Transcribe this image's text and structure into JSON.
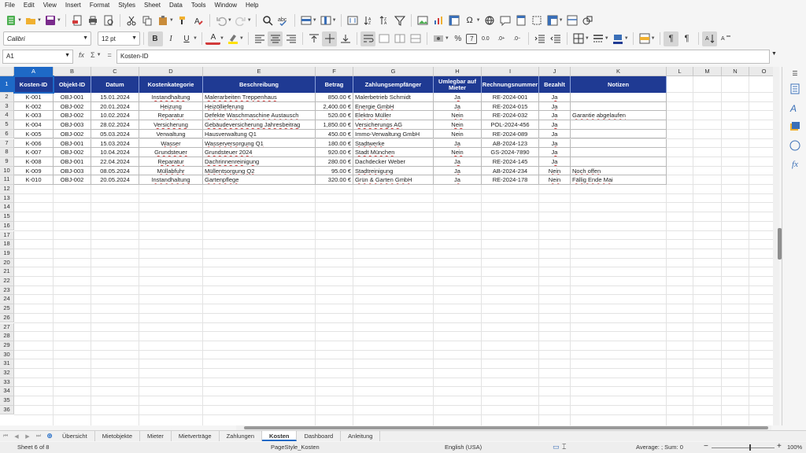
{
  "menu": [
    "File",
    "Edit",
    "View",
    "Insert",
    "Format",
    "Styles",
    "Sheet",
    "Data",
    "Tools",
    "Window",
    "Help"
  ],
  "format_toolbar": {
    "font_name": "Calibri",
    "font_size": "12 pt",
    "bold": "B",
    "italic": "I",
    "underline": "U",
    "font_color_glyph": "A",
    "percent": "%",
    "decimal_label": "0.0"
  },
  "formula_bar": {
    "cell_ref": "A1",
    "fx": "fx",
    "sigma": "Σ",
    "equals": "=",
    "content": "Kosten-ID"
  },
  "columns": [
    "A",
    "B",
    "C",
    "D",
    "E",
    "F",
    "G",
    "H",
    "I",
    "J",
    "K",
    "L",
    "M",
    "N",
    "O"
  ],
  "row_numbers": [
    "1",
    "2",
    "3",
    "4",
    "5",
    "6",
    "7",
    "8",
    "9",
    "10",
    "11",
    "12",
    "13",
    "14",
    "15",
    "16",
    "17",
    "18",
    "19",
    "20",
    "21",
    "22",
    "23",
    "24",
    "25",
    "26",
    "27",
    "28",
    "29",
    "30",
    "31",
    "32",
    "33",
    "34",
    "35",
    "36"
  ],
  "table": {
    "headers": [
      "Kosten-ID",
      "Objekt-ID",
      "Datum",
      "Kostenkategorie",
      "Beschreibung",
      "Betrag",
      "Zahlungsempfänger",
      "Umlegbar auf Mieter",
      "Rechnungsnummer",
      "Bezahlt",
      "Notizen"
    ],
    "rows": [
      [
        "K-001",
        "OBJ-001",
        "15.01.2024",
        "Instandhaltung",
        "Malerarbeiten Treppenhaus",
        "850.00 €",
        "Malerbetrieb Schmidt",
        "Ja",
        "RE-2024-001",
        "Ja",
        ""
      ],
      [
        "K-002",
        "OBJ-002",
        "20.01.2024",
        "Heizung",
        "Heizöllieferung",
        "2,400.00 €",
        "Energie GmbH",
        "Ja",
        "RE-2024-015",
        "Ja",
        ""
      ],
      [
        "K-003",
        "OBJ-002",
        "10.02.2024",
        "Reparatur",
        "Defekte Waschmaschine Austausch",
        "520.00 €",
        "Elektro Müller",
        "Nein",
        "RE-2024-032",
        "Ja",
        "Garantie abgelaufen"
      ],
      [
        "K-004",
        "OBJ-003",
        "28.02.2024",
        "Versicherung",
        "Gebäudeversicherung Jahresbeitrag",
        "1,850.00 €",
        "Versicherungs AG",
        "Nein",
        "POL-2024-456",
        "Ja",
        ""
      ],
      [
        "K-005",
        "OBJ-002",
        "05.03.2024",
        "Verwaltung",
        "Hausverwaltung Q1",
        "450.00 €",
        "Immo-Verwaltung GmbH",
        "Nein",
        "RE-2024-089",
        "Ja",
        ""
      ],
      [
        "K-006",
        "OBJ-001",
        "15.03.2024",
        "Wasser",
        "Wasserversorgung Q1",
        "180.00 €",
        "Stadtwerke",
        "Ja",
        "AB-2024-123",
        "Ja",
        ""
      ],
      [
        "K-007",
        "OBJ-002",
        "10.04.2024",
        "Grundsteuer",
        "Grundsteuer 2024",
        "920.00 €",
        "Stadt München",
        "Nein",
        "GS-2024-7890",
        "Ja",
        ""
      ],
      [
        "K-008",
        "OBJ-001",
        "22.04.2024",
        "Reparatur",
        "Dachrinnenreinigung",
        "280.00 €",
        "Dachdecker Weber",
        "Ja",
        "RE-2024-145",
        "Ja",
        ""
      ],
      [
        "K-009",
        "OBJ-003",
        "08.05.2024",
        "Müllabfuhr",
        "Müllentsorgung Q2",
        "95.00 €",
        "Stadtreinigung",
        "Ja",
        "AB-2024-234",
        "Nein",
        "Noch offen"
      ],
      [
        "K-010",
        "OBJ-002",
        "20.05.2024",
        "Instandhaltung",
        "Gartenpflege",
        "320.00 €",
        "Grün & Garten GmbH",
        "Ja",
        "RE-2024-178",
        "Nein",
        "Fällig Ende Mai"
      ]
    ]
  },
  "sheet_tabs": [
    "Übersicht",
    "Mietobjekte",
    "Mieter",
    "Mietverträge",
    "Zahlungen",
    "Kosten",
    "Dashboard",
    "Anleitung"
  ],
  "active_tab": "Kosten",
  "status": {
    "sheet": "Sheet 6 of 8",
    "page_style": "PageStyle_Kosten",
    "language": "English (USA)",
    "summary": "Average: ; Sum: 0",
    "zoom": "100%"
  },
  "colors": {
    "header_bg": "#1f3a93",
    "selection": "#1e69c6",
    "spell_underline": "#d23a3a"
  }
}
